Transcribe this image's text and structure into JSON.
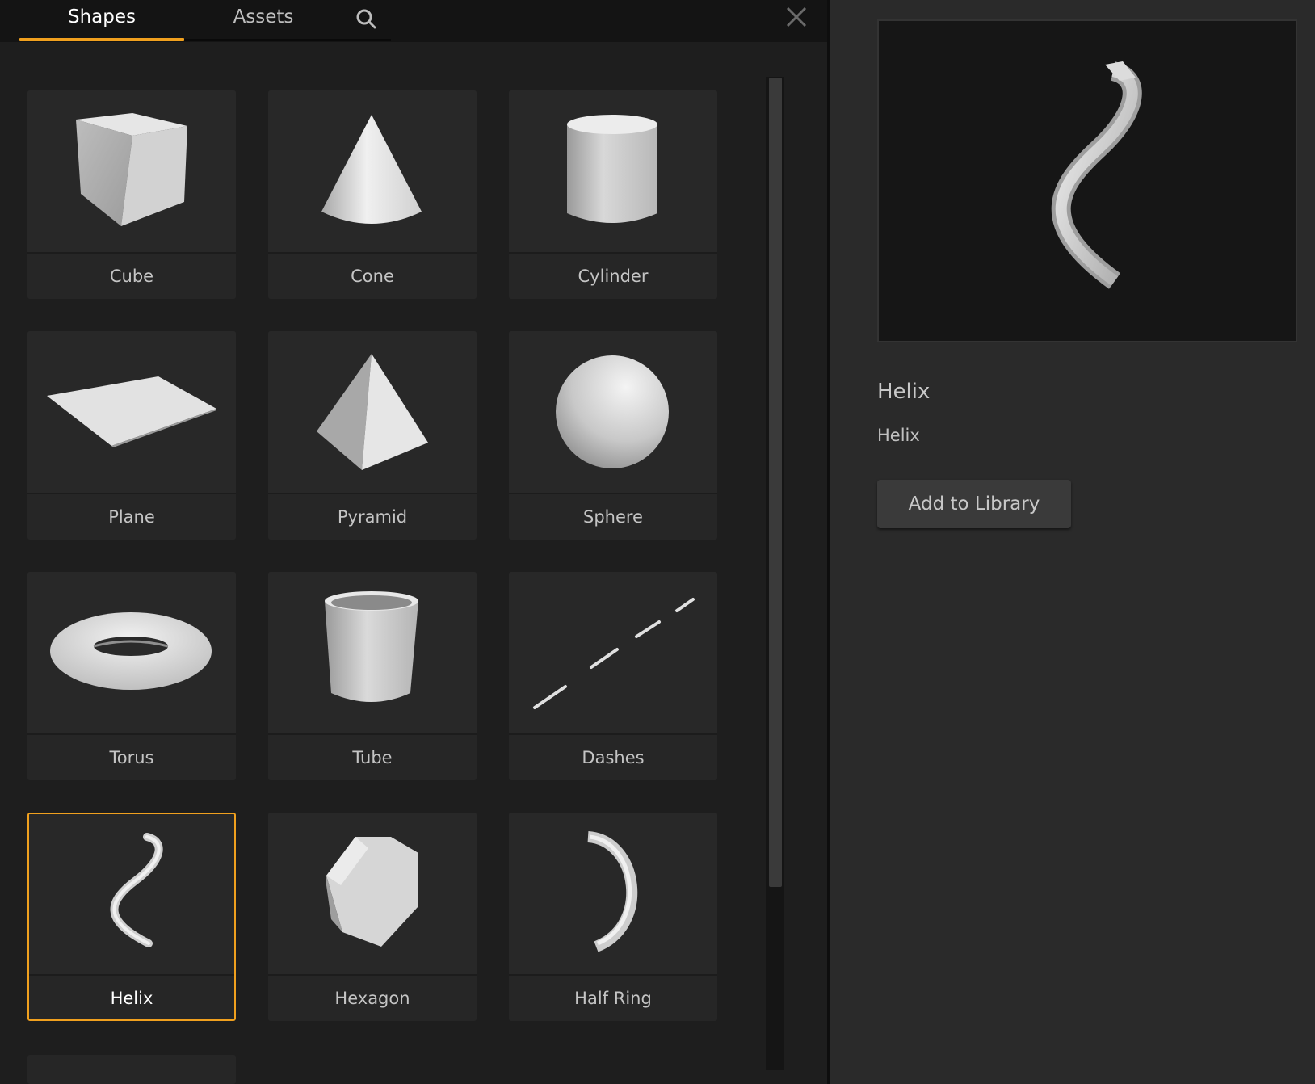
{
  "tabs": {
    "shapes_label": "Shapes",
    "assets_label": "Assets",
    "search_icon": "search-icon",
    "close_icon": "close-icon"
  },
  "shapes": [
    {
      "label": "Cube",
      "icon": "cube-icon"
    },
    {
      "label": "Cone",
      "icon": "cone-icon"
    },
    {
      "label": "Cylinder",
      "icon": "cylinder-icon"
    },
    {
      "label": "Plane",
      "icon": "plane-icon"
    },
    {
      "label": "Pyramid",
      "icon": "pyramid-icon"
    },
    {
      "label": "Sphere",
      "icon": "sphere-icon"
    },
    {
      "label": "Torus",
      "icon": "torus-icon"
    },
    {
      "label": "Tube",
      "icon": "tube-icon"
    },
    {
      "label": "Dashes",
      "icon": "dashes-icon"
    },
    {
      "label": "Helix",
      "icon": "helix-icon"
    },
    {
      "label": "Hexagon",
      "icon": "hexagon-icon"
    },
    {
      "label": "Half Ring",
      "icon": "half-ring-icon"
    }
  ],
  "selected": "Helix",
  "detail": {
    "title": "Helix",
    "subtitle": "Helix",
    "add_button": "Add to Library"
  },
  "colors": {
    "accent": "#f0a01e",
    "panel_bg": "#1e1e1e",
    "right_bg": "#2a2a2a"
  }
}
